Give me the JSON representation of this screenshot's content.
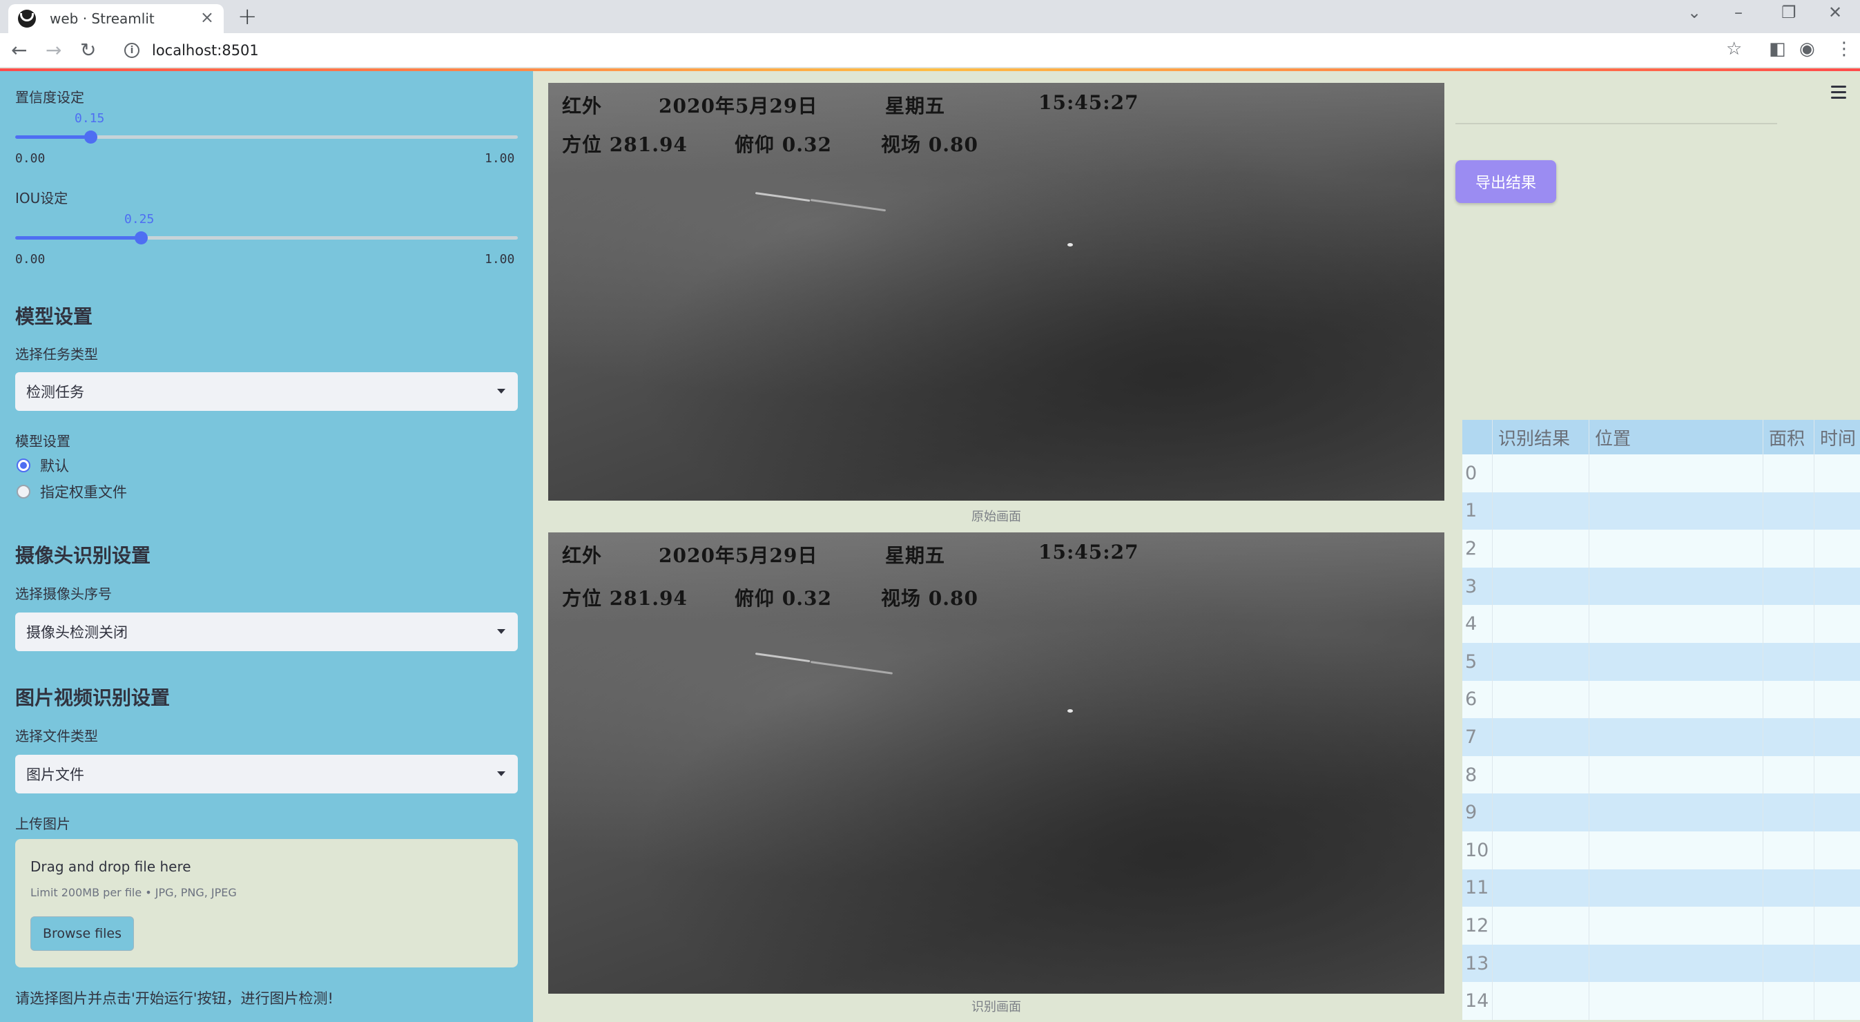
{
  "browser": {
    "tab_title": "web · Streamlit",
    "url": "localhost:8501"
  },
  "sidebar": {
    "confidence": {
      "label": "置信度设定",
      "value": "0.15",
      "value_num": 0.15,
      "min": "0.00",
      "max": "1.00"
    },
    "iou": {
      "label": "IOU设定",
      "value": "0.25",
      "value_num": 0.25,
      "min": "0.00",
      "max": "1.00"
    },
    "model_settings": {
      "heading": "模型设置",
      "task_label": "选择任务类型",
      "task_value": "检测任务",
      "weights_label": "模型设置",
      "weights_options": [
        "默认",
        "指定权重文件"
      ],
      "weights_selected": 0
    },
    "camera": {
      "heading": "摄像头识别设置",
      "select_label": "选择摄像头序号",
      "select_value": "摄像头检测关闭"
    },
    "media": {
      "heading": "图片视频识别设置",
      "type_label": "选择文件类型",
      "type_value": "图片文件",
      "upload_label": "上传图片",
      "drop_text": "Drag and drop file here",
      "limit_text": "Limit 200MB per file • JPG, PNG, JPEG",
      "browse_label": "Browse files"
    },
    "hint": "请选择图片并点击'开始运行'按钮，进行图片检测!"
  },
  "main": {
    "osd": {
      "mode": "红外",
      "date": "2020年5月29日",
      "weekday": "星期五",
      "time": "15:45:27",
      "azimuth": "方位 281.94",
      "pitch": "俯仰 0.32",
      "fov": "视场 0.80"
    },
    "original_caption": "原始画面",
    "result_caption": "识别画面"
  },
  "right": {
    "export_label": "导出结果",
    "table": {
      "columns": [
        "",
        "识别结果",
        "位置",
        "面积",
        "时间"
      ],
      "row_indices": [
        "0",
        "1",
        "2",
        "3",
        "4",
        "5",
        "6",
        "7",
        "8",
        "9",
        "10",
        "11",
        "12",
        "13",
        "14"
      ]
    }
  },
  "colors": {
    "sidebar_bg": "#7ac5dc",
    "accent": "#4e6ef2",
    "export_button": "#9b8cf2",
    "main_bg": "#dfe6d4"
  }
}
